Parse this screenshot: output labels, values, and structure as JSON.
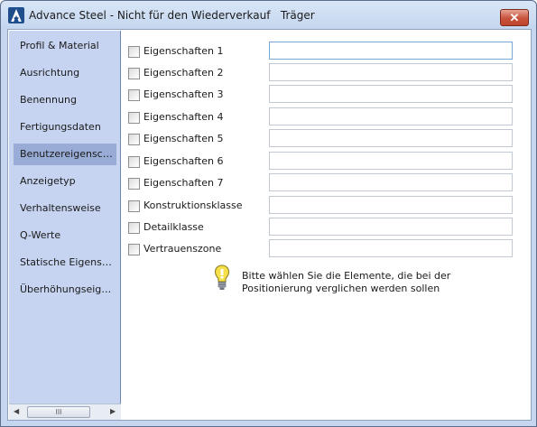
{
  "window": {
    "title": "Advance Steel - Nicht für den Wiederverkauf   Träger",
    "close_symbol": "✕",
    "icons": {
      "app": "advance-steel-logo-icon",
      "close": "close-icon",
      "hint": "lightbulb-icon"
    }
  },
  "sidebar": {
    "items": [
      {
        "label": "Profil & Material"
      },
      {
        "label": "Ausrichtung"
      },
      {
        "label": "Benennung"
      },
      {
        "label": "Fertigungsdaten"
      },
      {
        "label": "Benutzereigenschaften"
      },
      {
        "label": "Anzeigetyp"
      },
      {
        "label": "Verhaltensweise"
      },
      {
        "label": "Q-Werte"
      },
      {
        "label": "Statische Eigenschaften"
      },
      {
        "label": "Überhöhungseigenschaften"
      }
    ],
    "selected_index": 4,
    "scrollbar": {
      "left_arrow": "◀",
      "right_arrow": "▶",
      "thumb_grip": "III"
    }
  },
  "properties": [
    {
      "label": "Eigenschaften 1",
      "value": "",
      "checked": false
    },
    {
      "label": "Eigenschaften 2",
      "value": "",
      "checked": false
    },
    {
      "label": "Eigenschaften 3",
      "value": "",
      "checked": false
    },
    {
      "label": "Eigenschaften 4",
      "value": "",
      "checked": false
    },
    {
      "label": "Eigenschaften 5",
      "value": "",
      "checked": false
    },
    {
      "label": "Eigenschaften 6",
      "value": "",
      "checked": false
    },
    {
      "label": "Eigenschaften 7",
      "value": "",
      "checked": false
    },
    {
      "label": "Konstruktionsklasse",
      "value": "",
      "checked": false
    },
    {
      "label": "Detailklasse",
      "value": "",
      "checked": false
    },
    {
      "label": "Vertrauenszone",
      "value": "",
      "checked": false
    }
  ],
  "hint": {
    "text": "Bitte wählen Sie die Elemente, die bei der Positionierung verglichen werden sollen"
  },
  "colors": {
    "selected_item": "#98acd6",
    "sidebar_bg": "#c6d4f1",
    "close_button": "#c8533c",
    "focused_border": "#7aa7d6"
  }
}
